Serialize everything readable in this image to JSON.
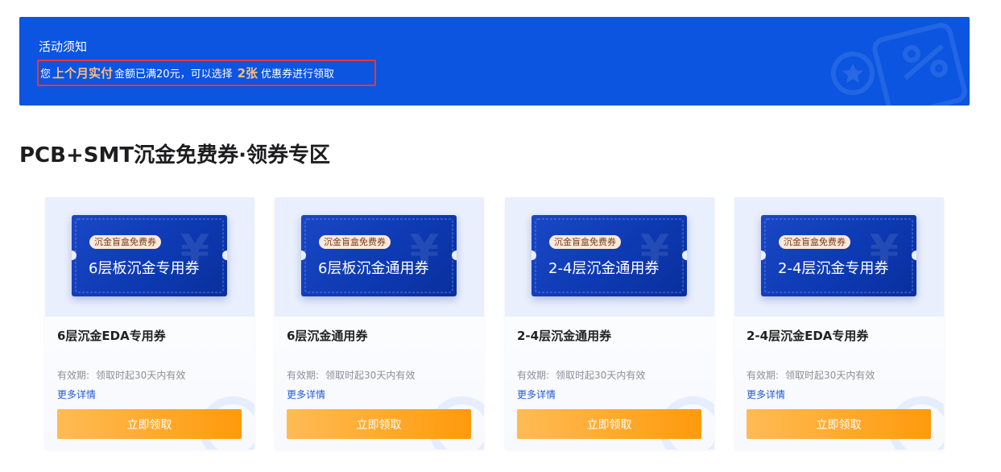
{
  "banner": {
    "title": "活动须知",
    "notice": {
      "prefix": "您",
      "highlight": "上个月实付",
      "middle": "金额已满20元，可以选择",
      "count": "2张",
      "suffix": "优惠券进行领取"
    },
    "colors": {
      "background": "#0b55e0",
      "highlight": "#ffbd7a",
      "notice_border": "#e53935"
    }
  },
  "section": {
    "title": "PCB+SMT沉金免费券·领券专区"
  },
  "coupons": [
    {
      "badge": "沉金盲盒免费券",
      "ticket_name": "6层板沉金专用券",
      "name": "6层沉金EDA专用券",
      "validity_label": "有效期:",
      "validity_value": "领取时起30天内有效",
      "more": "更多详情",
      "button": "立即领取"
    },
    {
      "badge": "沉金盲盒免费券",
      "ticket_name": "6层板沉金通用券",
      "name": "6层沉金通用券",
      "validity_label": "有效期:",
      "validity_value": "领取时起30天内有效",
      "more": "更多详情",
      "button": "立即领取"
    },
    {
      "badge": "沉金盲盒免费券",
      "ticket_name": "2-4层沉金通用券",
      "name": "2-4层沉金通用券",
      "validity_label": "有效期:",
      "validity_value": "领取时起30天内有效",
      "more": "更多详情",
      "button": "立即领取"
    },
    {
      "badge": "沉金盲盒免费券",
      "ticket_name": "2-4层沉金专用券",
      "name": "2-4层沉金EDA专用券",
      "validity_label": "有效期:",
      "validity_value": "领取时起30天内有效",
      "more": "更多详情",
      "button": "立即领取"
    }
  ],
  "icons": {
    "banner_decoration": "coupon-tag-icon",
    "ticket_symbol": "yen-icon"
  },
  "colors": {
    "button_gradient_start": "#ffbb55",
    "button_gradient_end": "#ff9a0c",
    "ticket": "#1a47c4",
    "link": "#1f5bd8"
  }
}
